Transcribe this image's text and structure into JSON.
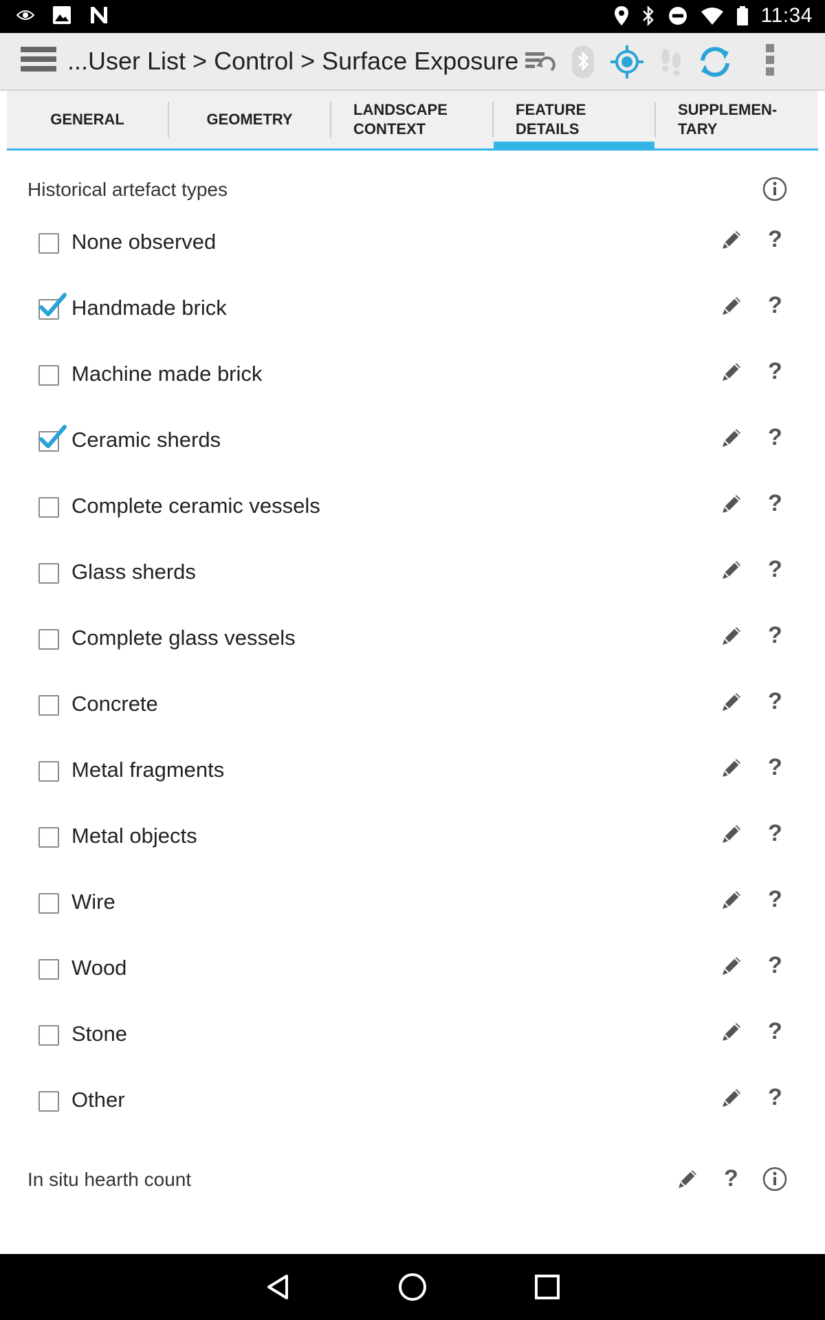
{
  "status_bar": {
    "time": "11:34",
    "left_icons": [
      "eye-icon",
      "image-icon",
      "n-logo-icon"
    ],
    "right_icons": [
      "location-pin-icon",
      "bluetooth-icon",
      "do-not-disturb-icon",
      "wifi-icon",
      "battery-icon"
    ]
  },
  "app_bar": {
    "title": "...User List > Control > Surface Exposure",
    "icons": [
      "sync-settings-icon",
      "bluetooth-disabled-icon",
      "gps-target-icon",
      "footsteps-icon",
      "refresh-icon",
      "overflow-menu-icon"
    ]
  },
  "tabs": [
    {
      "label": "GENERAL"
    },
    {
      "label": "GEOMETRY"
    },
    {
      "label": "LANDSCAPE\nCONTEXT"
    },
    {
      "label": "FEATURE\nDETAILS",
      "active": true
    },
    {
      "label": "SUPPLEMEN-\nTARY"
    }
  ],
  "section": {
    "title": "Historical artefact types",
    "options": [
      {
        "label": "None observed",
        "checked": false
      },
      {
        "label": "Handmade brick",
        "checked": true
      },
      {
        "label": "Machine made brick",
        "checked": false
      },
      {
        "label": "Ceramic sherds",
        "checked": true
      },
      {
        "label": "Complete ceramic vessels",
        "checked": false
      },
      {
        "label": "Glass sherds",
        "checked": false
      },
      {
        "label": "Complete glass vessels",
        "checked": false
      },
      {
        "label": "Concrete",
        "checked": false
      },
      {
        "label": "Metal fragments",
        "checked": false
      },
      {
        "label": "Metal objects",
        "checked": false
      },
      {
        "label": "Wire",
        "checked": false
      },
      {
        "label": "Wood",
        "checked": false
      },
      {
        "label": "Stone",
        "checked": false
      },
      {
        "label": "Other",
        "checked": false
      }
    ]
  },
  "hearth": {
    "label": "In situ hearth count"
  },
  "help_glyph": "?",
  "colors": {
    "accent": "#33b5e5",
    "check": "#2aa3d6",
    "icon_gray": "#555555"
  }
}
